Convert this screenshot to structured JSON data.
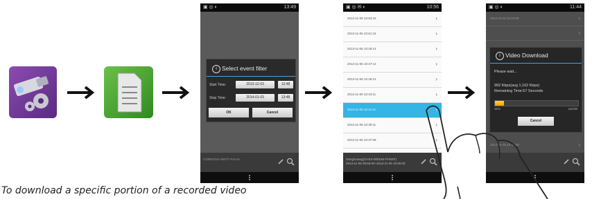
{
  "colors": {
    "accent": "#33b5e5",
    "progress": "#f0a000"
  },
  "icons": [
    "camera-settings-icon",
    "document-icon"
  ],
  "phone1": {
    "status_time": "13:49",
    "dialog_title": "Select event filter",
    "start_label": "Start Time:",
    "start_date": "2013-12-03",
    "start_time": "12:48",
    "stop_label": "Stop Time:",
    "stop_date": "2014-01-03",
    "stop_time": "13:48",
    "ok": "OK",
    "cancel": "Cancel",
    "footer": "CORE2016-4N6TT-FAUAL"
  },
  "phone2": {
    "status_time": "10:56",
    "rows": [
      "2013-11-06 10:53:18",
      "2013-11-06 10:51:16",
      "2013-11-06 10:49:14",
      "2013-11-06 10:47:13",
      "2013-11-06 10:45:12",
      "2013-11-06 10:43:11",
      "2013-11-06 10:41:11",
      "2013-11-06 10:39:11",
      "2013-11-06 10:37:08"
    ],
    "selected_index": 6,
    "footer_line1": "GengGuang(CHXX-000156-TFMXF)",
    "footer_line2": "2013-11-06 09:55:00~2013-11-06 10:55:00"
  },
  "phone3": {
    "status_time": "11:44",
    "rows_top": [
      "2014-01-03 11:02:00",
      ""
    ],
    "row_bottom": "2014-01-03 10:43:58",
    "dialog_title": "Video Download",
    "please_wait": "Please wait...",
    "speed": "992 Kbps(avg  1,162 Kbps)",
    "remaining": "Remaining Time:57 Seconds",
    "progress_percent": 11,
    "progress_left": "11%",
    "progress_right": "11/100",
    "cancel": "Cancel"
  },
  "caption": "To download a specific portion of a recorded video"
}
